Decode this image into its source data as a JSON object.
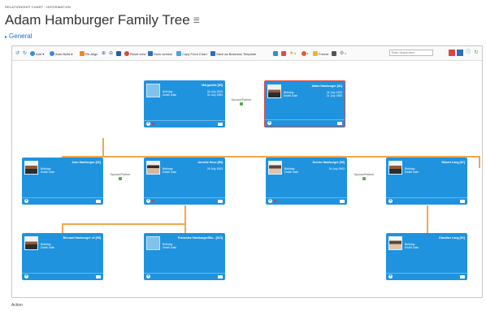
{
  "header": {
    "breadcrumb": "RELATIONSHIP CHART : INFORMATION",
    "title": "Adam Hamburger Family Tree",
    "title_icon": "list-icon",
    "section": "General"
  },
  "toolbar": {
    "undo_icon": "↺",
    "redo_icon": "↻",
    "add": "Add ▾",
    "auto_build": "Auto Build ▾",
    "re_align": "Re-Align",
    "reset_view": "Reset view",
    "save_version": "Save version",
    "copy_from_chart": "Copy From Chart",
    "save_business_template": "Save as Business Template",
    "freeze": "Freeze",
    "search_placeholder": "Enter Search term"
  },
  "nodes": {
    "marguerite": {
      "name": "Marguerite [83]",
      "birth_label": "Birthday",
      "birth": "26 July 1933",
      "death_label": "Death Date",
      "death": "30 July 1983"
    },
    "adam": {
      "name": "Adam Hamburger [81]",
      "birth_label": "Birthday",
      "birth": "04 July 1933",
      "death_label": "Death Date",
      "death": "21 July 1983"
    },
    "jean": {
      "name": "Jean Hamburger [91]",
      "birth_label": "Birthday",
      "death_label": "Death Date"
    },
    "annette": {
      "name": "Annette Hove [89]",
      "birth_label": "Birthday",
      "birth": "26 July 1933",
      "death_label": "Death Date"
    },
    "denise": {
      "name": "Denise Hamburger [99]",
      "birth_label": "Birthday",
      "birth": "04 July 1963",
      "death_label": "Death Date"
    },
    "robert": {
      "name": "Robert Lang [87]",
      "birth_label": "Birthday",
      "death_label": "Death Date"
    },
    "bernard": {
      "name": "Bernard Hamburger v2 [99]",
      "birth_label": "Birthday",
      "death_label": "Death Date"
    },
    "francoise": {
      "name": "Francoise Hamburger/Ba... [913]",
      "birth_label": "Birthday",
      "death_label": "Death Date"
    },
    "claudine": {
      "name": "Claudine Lang [91]",
      "birth_label": "Birthday",
      "death_label": "Death Date"
    }
  },
  "spouse_label": "Spouse/Partner",
  "footer": {
    "action": "Action"
  },
  "colors": {
    "node": "#1f93de",
    "selected": "#e2453c",
    "connector": "#f2a74b"
  }
}
